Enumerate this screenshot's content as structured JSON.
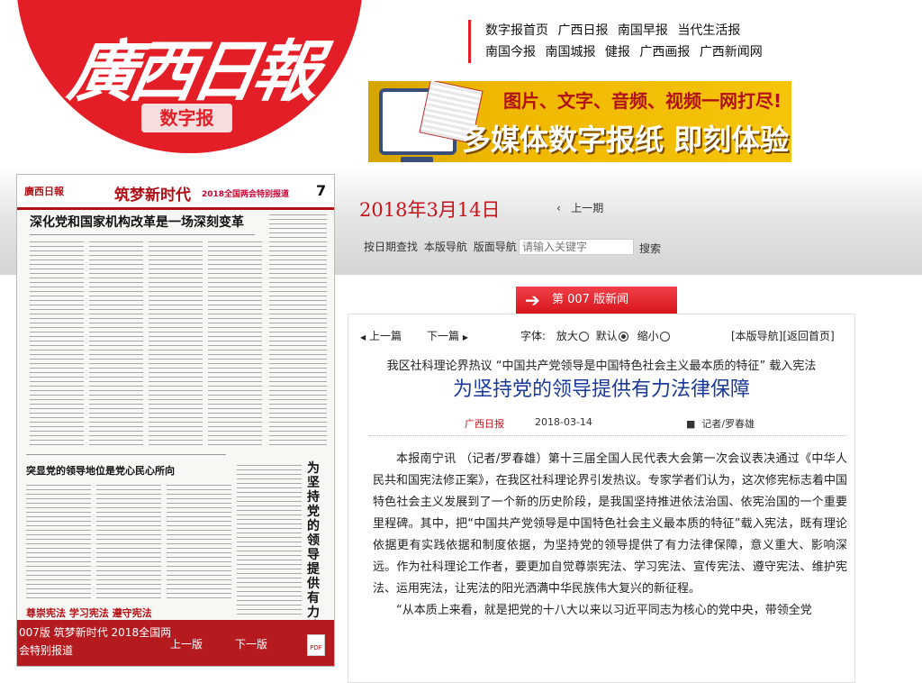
{
  "header": {
    "logo_text": "廣西日報",
    "logo_badge": "数字报",
    "links_row1": [
      "数字报首页",
      "广西日报",
      "南国早报",
      "当代生活报"
    ],
    "links_row2": [
      "南国今报",
      "南国城报",
      "健报",
      "广西画报",
      "广西新闻网"
    ]
  },
  "banner": {
    "line1": "图片、文字、音频、视频一网打尽!",
    "line2": "多媒体数字报纸  即刻体验"
  },
  "thumbnail": {
    "masthead_paper": "廣西日報",
    "masthead_section": "筑梦新时代",
    "masthead_special": "2018全国两会特别报道",
    "masthead_page": "7",
    "headline1": "深化党和国家机构改革是一场深刻变革",
    "headline2": "突显党的领导地位是党心民心所向",
    "vertical_headline": "为坚持党的领导提供有力法律保障",
    "slogan": "尊崇宪法  学习宪法  遵守宪法",
    "caption": "007版 筑梦新时代 2018全国两会特别报道",
    "prev_page": "上一版",
    "next_page": "下一版"
  },
  "date": "2018年3月14日",
  "prev_issue": "上一期",
  "search": {
    "by_date": "按日期查找",
    "page_nav": "本版导航",
    "layout_nav": "版面导航",
    "placeholder": "请输入关键字",
    "button": "搜索"
  },
  "section_tab": "第 007 版新闻",
  "article_nav": {
    "prev_article": "上一篇",
    "next_article": "下一篇",
    "font_label": "字体:",
    "zoom_in": "放大",
    "default": "默认",
    "zoom_out": "缩小",
    "page_nav": "[本版导航]",
    "back_home": "[返回首页]"
  },
  "article": {
    "pretitle": "我区社科理论界热议 “中国共产党领导是中国特色社会主义最本质的特征” 载入宪法",
    "title": "为坚持党的领导提供有力法律保障",
    "source": "广西日报",
    "date": "2018-03-14",
    "author": "记者/罗春雄",
    "paragraph1": "本报南宁讯 （记者/罗春雄）第十三届全国人民代表大会第一次会议表决通过《中华人民共和国宪法修正案》，在我区社科理论界引发热议。专家学者们认为，这次修宪标志着中国特色社会主义发展到了一个新的历史阶段，是我国坚持推进依法治国、依宪治国的一个重要里程碑。其中，把“中国共产党领导是中国特色社会主义最本质的特征”载入宪法，既有理论依据更有实践依据和制度依据，为坚持党的领导提供了有力法律保障，意义重大、影响深远。作为社科理论工作者，要更加自觉尊崇宪法、学习宪法、宣传宪法、遵守宪法、维护宪法、运用宪法，让宪法的阳光洒满中华民族伟大复兴的新征程。",
    "paragraph2": "“从本质上来看，就是把党的十八大以来以习近平同志为核心的党中央，带领全党"
  },
  "colors": {
    "brand_red": "#e41e26",
    "title_blue": "#1a3a9a",
    "date_red": "#c8121a"
  }
}
